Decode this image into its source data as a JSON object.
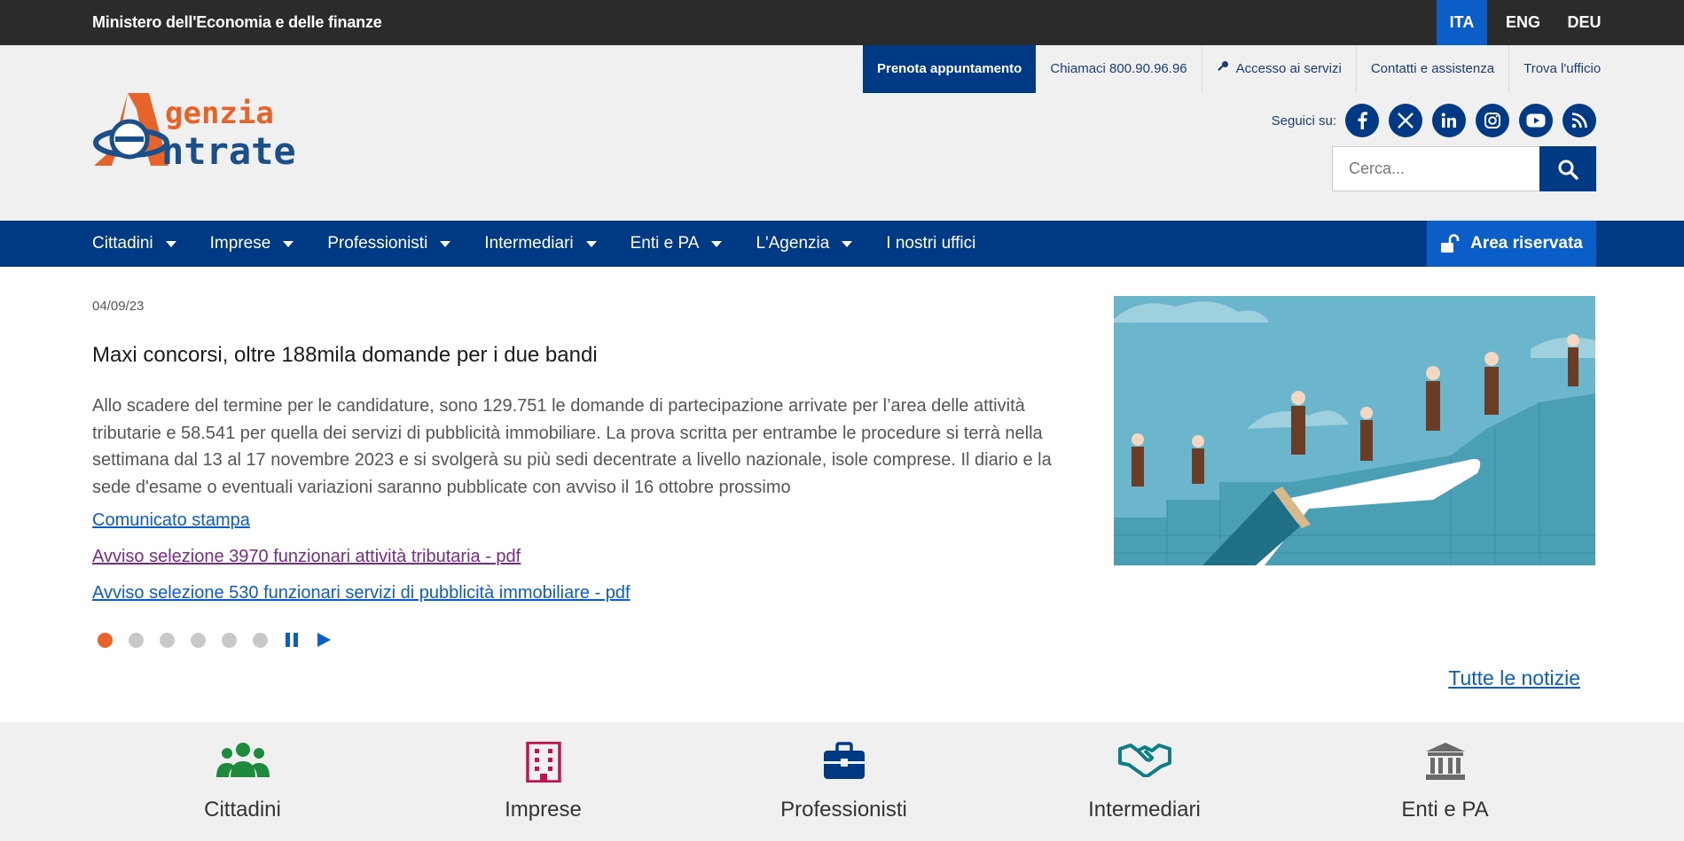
{
  "topbar": {
    "ministry": "Ministero dell'Economia e delle finanze",
    "languages": [
      {
        "label": "ITA",
        "active": true
      },
      {
        "label": "ENG",
        "active": false
      },
      {
        "label": "DEU",
        "active": false
      }
    ]
  },
  "utility": {
    "prenota": "Prenota appuntamento",
    "phone": "Chiamaci 800.90.96.96",
    "accesso": "Accesso ai servizi",
    "contatti": "Contatti e assistenza",
    "trova": "Trova l'ufficio"
  },
  "logo": {
    "line1": "genzia",
    "line2": "ntrate"
  },
  "social": {
    "label": "Seguici su:",
    "icons": [
      "facebook-icon",
      "x-twitter-icon",
      "linkedin-icon",
      "instagram-icon",
      "youtube-icon",
      "rss-icon"
    ]
  },
  "search": {
    "placeholder": "Cerca..."
  },
  "nav": {
    "items": [
      {
        "label": "Cittadini",
        "dropdown": true
      },
      {
        "label": "Imprese",
        "dropdown": true
      },
      {
        "label": "Professionisti",
        "dropdown": true
      },
      {
        "label": "Intermediari",
        "dropdown": true
      },
      {
        "label": "Enti e PA",
        "dropdown": true
      },
      {
        "label": "L'Agenzia",
        "dropdown": true
      },
      {
        "label": "I nostri uffici",
        "dropdown": false
      }
    ],
    "area_riservata": "Area riservata"
  },
  "news": {
    "date": "04/09/23",
    "title": "Maxi concorsi, oltre 188mila domande per i due bandi",
    "body": "Allo scadere del termine per le candidature, sono 129.751 le domande di partecipazione arrivate per l’area delle attività tributarie e 58.541 per quella dei servizi di pubblicità immobiliare. La prova scritta per entrambe le procedure si terrà nella settimana dal 13 al 17 novembre 2023 e si svolgerà su più sedi decentrate a livello nazionale, isole comprese. Il diario e la sede d'esame o eventuali variazioni saranno pubblicate con avviso il 16 ottobre prossimo",
    "links": [
      "Comunicato stampa",
      "Avviso selezione 3970 funzionari attività tributaria - pdf",
      "Avviso selezione 530 funzionari servizi di pubblicità immobiliare - pdf"
    ],
    "slides_total": 6,
    "slide_active": 1,
    "all_news": "Tutte le notizie"
  },
  "categories": [
    {
      "label": "Cittadini",
      "icon": "users-icon",
      "color": "#1e8a3c"
    },
    {
      "label": "Imprese",
      "icon": "building-icon",
      "color": "#c4124f"
    },
    {
      "label": "Professionisti",
      "icon": "briefcase-icon",
      "color": "#003a84"
    },
    {
      "label": "Intermediari",
      "icon": "handshake-icon",
      "color": "#0f7d87"
    },
    {
      "label": "Enti e PA",
      "icon": "institution-icon",
      "color": "#6a6a6a"
    }
  ],
  "colors": {
    "primary": "#003a84",
    "accent": "#0b5dc7",
    "orange": "#e8632a",
    "dark": "#2b2b2b"
  }
}
